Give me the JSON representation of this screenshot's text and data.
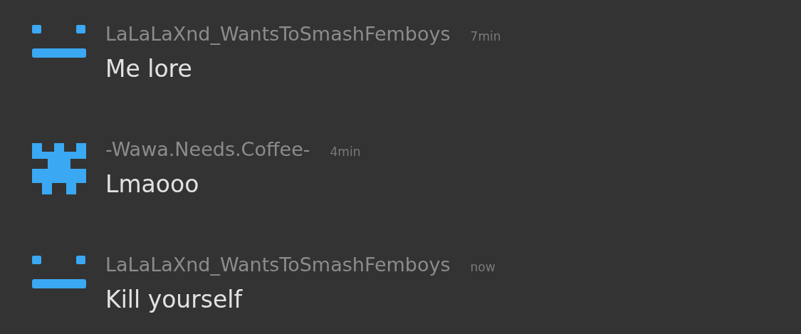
{
  "messages": [
    {
      "avatar": {
        "kind": "face"
      },
      "username": "LaLaLaXnd_WantsToSmashFemboys",
      "time": "7min",
      "text": "Me lore"
    },
    {
      "avatar": {
        "kind": "tower"
      },
      "username": "-Wawa.Needs.Coffee-",
      "time": "4min",
      "text": "Lmaooo"
    },
    {
      "avatar": {
        "kind": "face"
      },
      "username": "LaLaLaXnd_WantsToSmashFemboys",
      "time": "now",
      "text": "Kill yourself"
    }
  ]
}
